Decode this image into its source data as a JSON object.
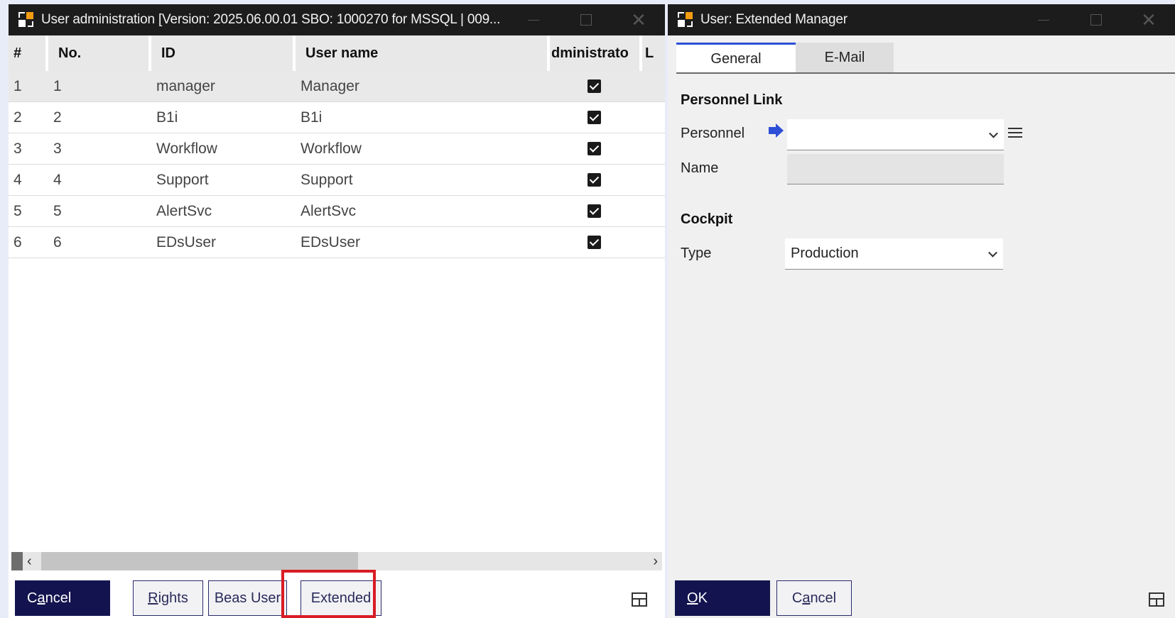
{
  "left_window": {
    "title": "User administration [Version: 2025.06.00.01 SBO: 1000270 for MSSQL | 009...",
    "columns": [
      "#",
      "No.",
      "ID",
      "User name",
      "dministrato",
      "L"
    ],
    "rows": [
      {
        "hash": "1",
        "no": "1",
        "id": "manager",
        "user_name": "Manager",
        "admin": true
      },
      {
        "hash": "2",
        "no": "2",
        "id": "B1i",
        "user_name": "B1i",
        "admin": true
      },
      {
        "hash": "3",
        "no": "3",
        "id": "Workflow",
        "user_name": "Workflow",
        "admin": true
      },
      {
        "hash": "4",
        "no": "4",
        "id": "Support",
        "user_name": "Support",
        "admin": true
      },
      {
        "hash": "5",
        "no": "5",
        "id": "AlertSvc",
        "user_name": "AlertSvc",
        "admin": true
      },
      {
        "hash": "6",
        "no": "6",
        "id": "EDsUser",
        "user_name": "EDsUser",
        "admin": true
      }
    ],
    "buttons": {
      "cancel_pre": "C",
      "cancel_ul": "a",
      "cancel_post": "ncel",
      "rights_ul": "R",
      "rights_post": "ights",
      "beas_user": "Beas User",
      "extended": "Extended"
    }
  },
  "right_window": {
    "title": "User: Extended  Manager",
    "tabs": [
      "General",
      "E-Mail"
    ],
    "personnel_link": {
      "heading": "Personnel Link",
      "personnel_label": "Personnel",
      "personnel_value": "",
      "name_label": "Name",
      "name_value": ""
    },
    "cockpit": {
      "heading": "Cockpit",
      "type_label": "Type",
      "type_value": "Production"
    },
    "buttons": {
      "ok_ul": "O",
      "ok_post": "K",
      "cancel_pre": "C",
      "cancel_ul": "a",
      "cancel_post": "ncel"
    }
  },
  "colors": {
    "titlebar": "#1c1c1c",
    "primary_button": "#13144f",
    "highlight": "#d91c24",
    "active_tab_accent": "#2b4fd8",
    "link_arrow": "#2d4ed6"
  },
  "icons": [
    "app-logo-icon",
    "minimize-icon",
    "maximize-icon",
    "close-icon",
    "checkbox-checked-icon",
    "scroll-left-icon",
    "scroll-right-icon",
    "form-layout-icon",
    "link-arrow-icon",
    "chevron-down-icon",
    "list-icon"
  ]
}
